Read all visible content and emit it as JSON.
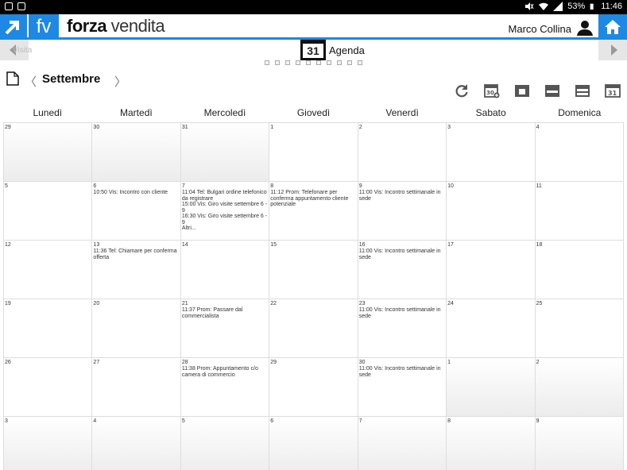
{
  "statusbar": {
    "battery": "53%",
    "time": "11:46"
  },
  "app": {
    "short": "fv",
    "brand_bold": "forza",
    "brand_rest": " vendita",
    "user": "Marco Collina"
  },
  "agenda": {
    "icon_day": "31",
    "label": "Agenda",
    "ghost": "Visita"
  },
  "nav": {
    "prev": "〈",
    "month": "Settembre",
    "next": "〉"
  },
  "weekdays": [
    "Lunedì",
    "Martedì",
    "Mercoledì",
    "Giovedì",
    "Venerdì",
    "Sabato",
    "Domenica"
  ],
  "weeks": [
    [
      {
        "day": "29",
        "other": true,
        "events": []
      },
      {
        "day": "30",
        "other": true,
        "events": []
      },
      {
        "day": "31",
        "other": true,
        "events": []
      },
      {
        "day": "1",
        "events": []
      },
      {
        "day": "2",
        "events": []
      },
      {
        "day": "3",
        "events": []
      },
      {
        "day": "4",
        "events": []
      }
    ],
    [
      {
        "day": "5",
        "events": []
      },
      {
        "day": "6",
        "events": [
          "10:50 Vis: Incontro con cliente"
        ]
      },
      {
        "day": "7",
        "events": [
          "11:04 Tel: Bulgari ordine telefonico da registrare",
          "15:00 Vis: Giro visite settembre 6 - 9",
          "16:30 Vis: Giro visite settembre 6 - 9",
          "Altri..."
        ]
      },
      {
        "day": "8",
        "events": [
          "11:12 Prom: Telefonare per conferma appuntamento cliente potenziale"
        ]
      },
      {
        "day": "9",
        "events": [
          "11:00 Vis: Incontro settimanale in sede"
        ]
      },
      {
        "day": "10",
        "events": []
      },
      {
        "day": "11",
        "events": []
      }
    ],
    [
      {
        "day": "12",
        "events": []
      },
      {
        "day": "13",
        "events": [
          "11:36 Tel: Chiamare per conferma offerta"
        ]
      },
      {
        "day": "14",
        "events": []
      },
      {
        "day": "15",
        "events": []
      },
      {
        "day": "16",
        "events": [
          "11:00 Vis: Incontro settimanale in sede"
        ]
      },
      {
        "day": "17",
        "events": []
      },
      {
        "day": "18",
        "events": []
      }
    ],
    [
      {
        "day": "19",
        "events": []
      },
      {
        "day": "20",
        "events": []
      },
      {
        "day": "21",
        "events": [
          "11:37 Prom: Passare dal commercialista"
        ]
      },
      {
        "day": "22",
        "events": []
      },
      {
        "day": "23",
        "events": [
          "11:00 Vis: Incontro settimanale in sede"
        ]
      },
      {
        "day": "24",
        "events": []
      },
      {
        "day": "25",
        "events": []
      }
    ],
    [
      {
        "day": "26",
        "events": []
      },
      {
        "day": "27",
        "events": []
      },
      {
        "day": "28",
        "events": [
          "11:38 Prom: Appuntamento c/o camera di commercio"
        ]
      },
      {
        "day": "29",
        "events": []
      },
      {
        "day": "30",
        "events": [
          "11:00 Vis: Incontro settimanale in sede"
        ]
      },
      {
        "day": "1",
        "other": true,
        "events": []
      },
      {
        "day": "2",
        "other": true,
        "events": []
      }
    ],
    [
      {
        "day": "3",
        "other": true,
        "events": []
      },
      {
        "day": "4",
        "other": true,
        "events": []
      },
      {
        "day": "5",
        "other": true,
        "events": []
      },
      {
        "day": "6",
        "other": true,
        "events": []
      },
      {
        "day": "7",
        "other": true,
        "events": []
      },
      {
        "day": "8",
        "other": true,
        "events": []
      },
      {
        "day": "9",
        "other": true,
        "events": []
      }
    ]
  ],
  "toolbar": {
    "icons": [
      "refresh-icon",
      "calendar-add-icon",
      "calendar-day-icon",
      "calendar-week-icon",
      "calendar-month-icon",
      "calendar-today-icon"
    ],
    "today_day": "31"
  },
  "colors": {
    "accent": "#1e88e5"
  }
}
